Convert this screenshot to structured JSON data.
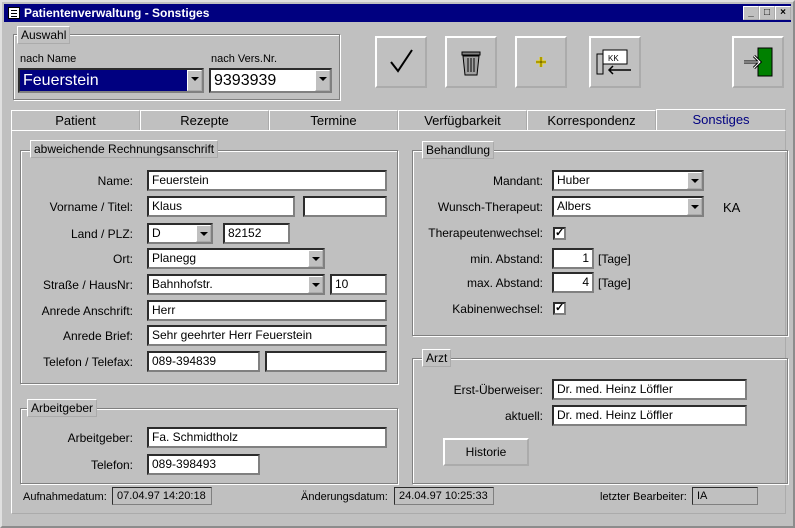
{
  "window": {
    "title": "Patientenverwaltung - Sonstiges"
  },
  "auswahl": {
    "label": "Auswahl",
    "by_name_label": "nach Name",
    "by_name_value": "Feuerstein",
    "by_insurance_label": "nach Vers.Nr.",
    "by_insurance_value": "9393939"
  },
  "toolbar": {
    "buttons": [
      "check-icon",
      "trash-icon",
      "plus-icon",
      "card-reader-icon",
      "exit-door-icon"
    ]
  },
  "tabs": [
    "Patient",
    "Rezepte",
    "Termine",
    "Verfügbarkeit",
    "Korrespondenz",
    "Sonstiges"
  ],
  "billing": {
    "group_label": "abweichende Rechnungsanschrift",
    "name_label": "Name:",
    "name_value": "Feuerstein",
    "firstname_label": "Vorname  /  Titel:",
    "firstname_value": "Klaus",
    "title_value": "",
    "country_label": "Land  /  PLZ:",
    "country_value": "D",
    "zip_value": "82152",
    "city_label": "Ort:",
    "city_value": "Planegg",
    "street_label": "Straße  /  HausNr:",
    "street_value": "Bahnhofstr.",
    "house_value": "10",
    "salutation_address_label": "Anrede Anschrift:",
    "salutation_address_value": "Herr",
    "salutation_letter_label": "Anrede Brief:",
    "salutation_letter_value": "Sehr geehrter Herr Feuerstein",
    "phone_label": "Telefon  /  Telefax:",
    "phone_value": "089-394839",
    "fax_value": ""
  },
  "employer": {
    "group_label": "Arbeitgeber",
    "employer_label": "Arbeitgeber:",
    "employer_value": "Fa. Schmidtholz",
    "phone_label": "Telefon:",
    "phone_value": "089-398493"
  },
  "treatment": {
    "group_label": "Behandlung",
    "client_label": "Mandant:",
    "client_value": "Huber",
    "therapist_label": "Wunsch-Therapeut:",
    "therapist_value": "Albers",
    "therapist_code": "KA",
    "therapist_change_label": "Therapeutenwechsel:",
    "therapist_change_checked": "✓",
    "min_gap_label": "min. Abstand:",
    "min_gap_value": "1",
    "min_gap_unit": "[Tage]",
    "max_gap_label": "max. Abstand:",
    "max_gap_value": "4",
    "max_gap_unit": "[Tage]",
    "cabin_change_label": "Kabinenwechsel:",
    "cabin_change_checked": "✓"
  },
  "doctor": {
    "group_label": "Arzt",
    "first_referrer_label": "Erst-Überweiser:",
    "first_referrer_value": "Dr. med. Heinz Löffler",
    "current_label": "aktuell:",
    "current_value": "Dr. med. Heinz Löffler",
    "history_button": "Historie"
  },
  "status": {
    "admission_label": "Aufnahmedatum:",
    "admission_value": "07.04.97 14:20:18",
    "changed_label": "Änderungsdatum:",
    "changed_value": "24.04.97 10:25:33",
    "editor_label": "letzter Bearbeiter:",
    "editor_value": "IA"
  }
}
